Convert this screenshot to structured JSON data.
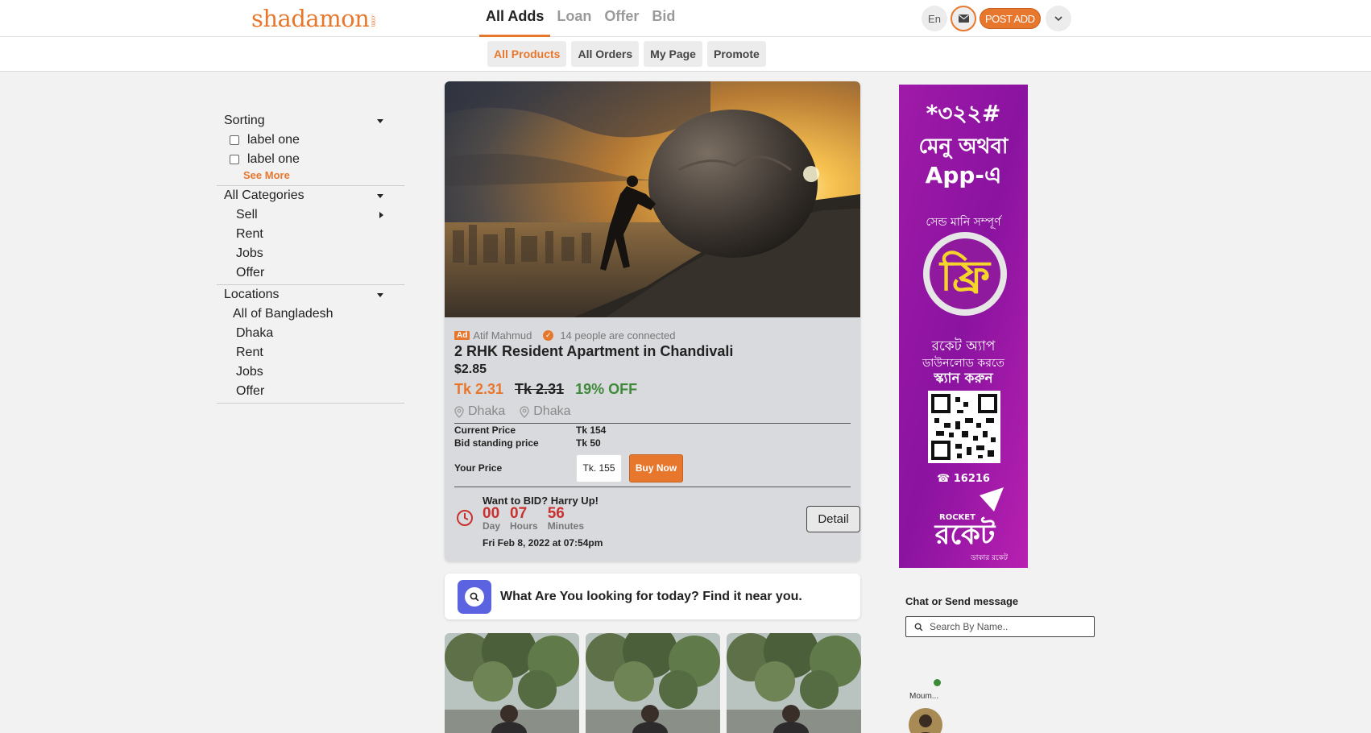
{
  "brand": {
    "logo": "shadamon",
    "logo_sub": ".com",
    "color": "#e8772e"
  },
  "nav": {
    "tabs": [
      {
        "label": "All Adds",
        "active": true
      },
      {
        "label": "Loan"
      },
      {
        "label": "Offer"
      },
      {
        "label": "Bid"
      }
    ],
    "lang": "En",
    "post_add": "POST ADD"
  },
  "subnav": {
    "tabs": [
      {
        "label": "All Products",
        "active": true
      },
      {
        "label": "All Orders"
      },
      {
        "label": "My Page"
      },
      {
        "label": "Promote"
      }
    ]
  },
  "sidebar": {
    "sorting": {
      "title": "Sorting",
      "options": [
        "label one",
        "label one"
      ],
      "see_more": "See More"
    },
    "categories": {
      "title": "All Categories",
      "items": [
        "Sell",
        "Rent",
        "Jobs",
        "Offer"
      ]
    },
    "locations": {
      "title": "Locations",
      "items": [
        "All of Bangladesh",
        "Dhaka",
        "Rent",
        "Jobs",
        "Offer"
      ]
    }
  },
  "listing": {
    "ad_badge": "Ad",
    "seller": "Atif Mahmud",
    "connections": "14 people are connected",
    "title": "2 RHK Resident Apartment in Chandivali",
    "usd_price": "$2.85",
    "price_new": "Tk 2.31",
    "price_old": "Tk 2.31",
    "discount": "19% OFF",
    "locations": [
      "Dhaka",
      "Dhaka"
    ],
    "current_price_label": "Current Price",
    "current_price": "Tk 154",
    "bid_price_label": "Bid standing price",
    "bid_price": "Tk 50",
    "your_price_label": "Your Price",
    "your_price_value": "Tk. 155",
    "buy_now": "Buy Now",
    "bid_title": "Want to BID? Harry Up!",
    "timer": [
      {
        "value": "00",
        "unit": "Day"
      },
      {
        "value": "07",
        "unit": "Hours"
      },
      {
        "value": "56",
        "unit": "Minutes"
      }
    ],
    "bid_date": "Fri Feb 8, 2022 at 07:54pm",
    "detail": "Detail"
  },
  "finder": {
    "text": "What Are You looking for today? Find it near you."
  },
  "chat": {
    "title": "Chat or Send message",
    "search_placeholder": "Search By Name..",
    "contacts": [
      {
        "name": "Moum...",
        "online": true
      }
    ]
  },
  "ad_banner": {
    "code": "*৩২২#",
    "line1": "মেনু অথবা",
    "line2": "App-এ",
    "tagline": "সেন্ড মানি সম্পূর্ণ",
    "free": "ফ্রি",
    "scan1": "রকেট অ্যাপ",
    "scan2": "ডাউনলোড করতে",
    "scan3": "স্ক্যান করুন",
    "hotline": "16216",
    "brand_en": "ROCKET",
    "brand_bn": "রকেট",
    "footer": "ডাকার রকেট"
  }
}
